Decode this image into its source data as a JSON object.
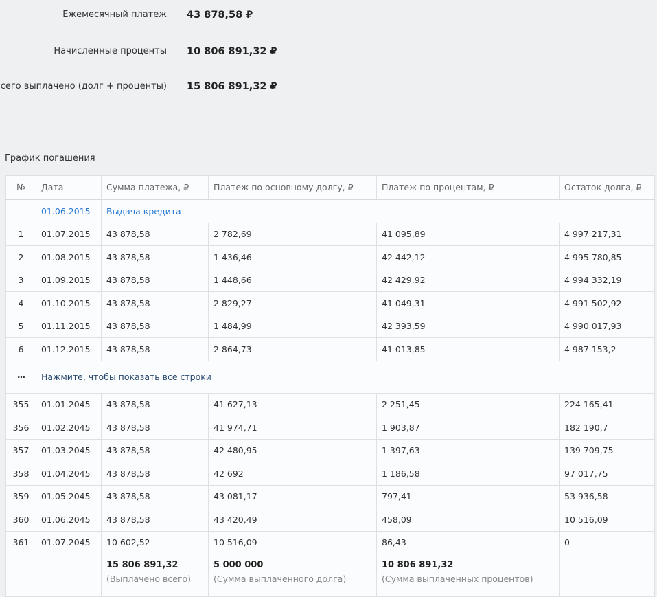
{
  "summary": {
    "monthly_label": "Ежемесячный платеж",
    "monthly_value": "43 878,58 ₽",
    "interest_label": "Начисленные проценты",
    "interest_value": "10 806 891,32 ₽",
    "total_label": "Всего выплачено (долг + проценты)",
    "total_value": "15 806 891,32 ₽"
  },
  "schedule": {
    "title": "График погашения",
    "headers": {
      "num": "№",
      "date": "Дата",
      "payment": "Сумма платежа, ₽",
      "principal": "Платеж по основному долгу, ₽",
      "interest": "Платеж по процентам, ₽",
      "balance": "Остаток долга, ₽"
    },
    "issue": {
      "date": "01.06.2015",
      "label": "Выдача кредита"
    },
    "rows_top": [
      {
        "n": "1",
        "date": "01.07.2015",
        "payment": "43 878,58",
        "principal": "2 782,69",
        "interest": "41 095,89",
        "balance": "4 997 217,31"
      },
      {
        "n": "2",
        "date": "01.08.2015",
        "payment": "43 878,58",
        "principal": "1 436,46",
        "interest": "42 442,12",
        "balance": "4 995 780,85"
      },
      {
        "n": "3",
        "date": "01.09.2015",
        "payment": "43 878,58",
        "principal": "1 448,66",
        "interest": "42 429,92",
        "balance": "4 994 332,19"
      },
      {
        "n": "4",
        "date": "01.10.2015",
        "payment": "43 878,58",
        "principal": "2 829,27",
        "interest": "41 049,31",
        "balance": "4 991 502,92"
      },
      {
        "n": "5",
        "date": "01.11.2015",
        "payment": "43 878,58",
        "principal": "1 484,99",
        "interest": "42 393,59",
        "balance": "4 990 017,93"
      },
      {
        "n": "6",
        "date": "01.12.2015",
        "payment": "43 878,58",
        "principal": "2 864,73",
        "interest": "41 013,85",
        "balance": "4 987 153,2"
      }
    ],
    "more": {
      "ellipsis": "···",
      "link": "Нажмите, чтобы показать все строки"
    },
    "rows_bottom": [
      {
        "n": "355",
        "date": "01.01.2045",
        "payment": "43 878,58",
        "principal": "41 627,13",
        "interest": "2 251,45",
        "balance": "224 165,41"
      },
      {
        "n": "356",
        "date": "01.02.2045",
        "payment": "43 878,58",
        "principal": "41 974,71",
        "interest": "1 903,87",
        "balance": "182 190,7"
      },
      {
        "n": "357",
        "date": "01.03.2045",
        "payment": "43 878,58",
        "principal": "42 480,95",
        "interest": "1 397,63",
        "balance": "139 709,75"
      },
      {
        "n": "358",
        "date": "01.04.2045",
        "payment": "43 878,58",
        "principal": "42 692",
        "interest": "1 186,58",
        "balance": "97 017,75"
      },
      {
        "n": "359",
        "date": "01.05.2045",
        "payment": "43 878,58",
        "principal": "43 081,17",
        "interest": "797,41",
        "balance": "53 936,58"
      },
      {
        "n": "360",
        "date": "01.06.2045",
        "payment": "43 878,58",
        "principal": "43 420,49",
        "interest": "458,09",
        "balance": "10 516,09"
      },
      {
        "n": "361",
        "date": "01.07.2045",
        "payment": "10 602,52",
        "principal": "10 516,09",
        "interest": "86,43",
        "balance": "0"
      }
    ],
    "totals": {
      "payment_value": "15 806 891,32",
      "payment_caption": "(Выплачено всего)",
      "principal_value": "5 000 000",
      "principal_caption": "(Сумма выплаченного долга)",
      "interest_value": "10 806 891,32",
      "interest_caption": "(Сумма выплаченных процентов)"
    }
  }
}
